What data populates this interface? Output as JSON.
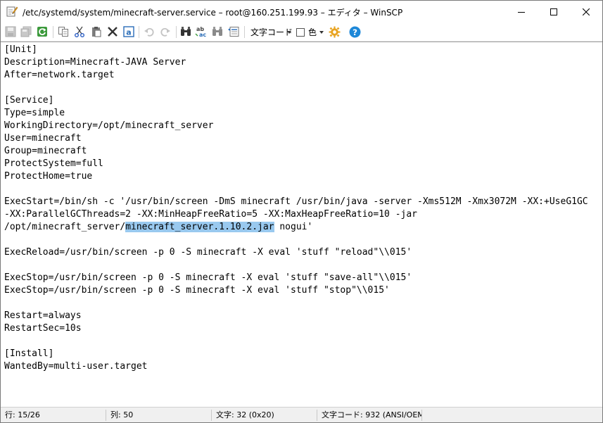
{
  "window": {
    "title": "/etc/systemd/system/minecraft-server.service – root@160.251.199.93 – エディタ – WinSCP"
  },
  "toolbar": {
    "encoding_label": "文字コード",
    "color_label": "色",
    "icons": [
      "save-icon",
      "save-all-icon",
      "reload-icon",
      "copy-icon",
      "cut-icon",
      "paste-icon",
      "delete-icon",
      "select-all-icon",
      "undo-icon",
      "redo-icon",
      "find-icon",
      "replace-icon",
      "find-next-icon",
      "goto-line-icon",
      "preferences-icon",
      "help-icon"
    ]
  },
  "editor": {
    "lines": [
      "[Unit]",
      "Description=Minecraft-JAVA Server",
      "After=network.target",
      "",
      "[Service]",
      "Type=simple",
      "WorkingDirectory=/opt/minecraft_server",
      "User=minecraft",
      "Group=minecraft",
      "ProtectSystem=full",
      "ProtectHome=true",
      "",
      "ExecStart=/bin/sh -c '/usr/bin/screen -DmS minecraft /usr/bin/java -server -Xms512M -Xmx3072M -XX:+UseG1GC",
      "-XX:ParallelGCThreads=2 -XX:MinHeapFreeRatio=5 -XX:MaxHeapFreeRatio=10 -jar",
      "",
      "",
      "ExecReload=/usr/bin/screen -p 0 -S minecraft -X eval 'stuff \"reload\"\\\\015'",
      "",
      "ExecStop=/usr/bin/screen -p 0 -S minecraft -X eval 'stuff \"save-all\"\\\\015'",
      "ExecStop=/usr/bin/screen -p 0 -S minecraft -X eval 'stuff \"stop\"\\\\015'",
      "",
      "Restart=always",
      "RestartSec=10s",
      "",
      "[Install]",
      "WantedBy=multi-user.target"
    ],
    "line15": {
      "before": "/opt/minecraft_server/",
      "selected": "minecraft_server.1.10.2.jar",
      "after": " nogui'"
    }
  },
  "status": {
    "line": "行: 15/26",
    "column": "列: 50",
    "char": "文字: 32 (0x20)",
    "encoding": "文字コード: 932  (ANSI/OEM"
  }
}
